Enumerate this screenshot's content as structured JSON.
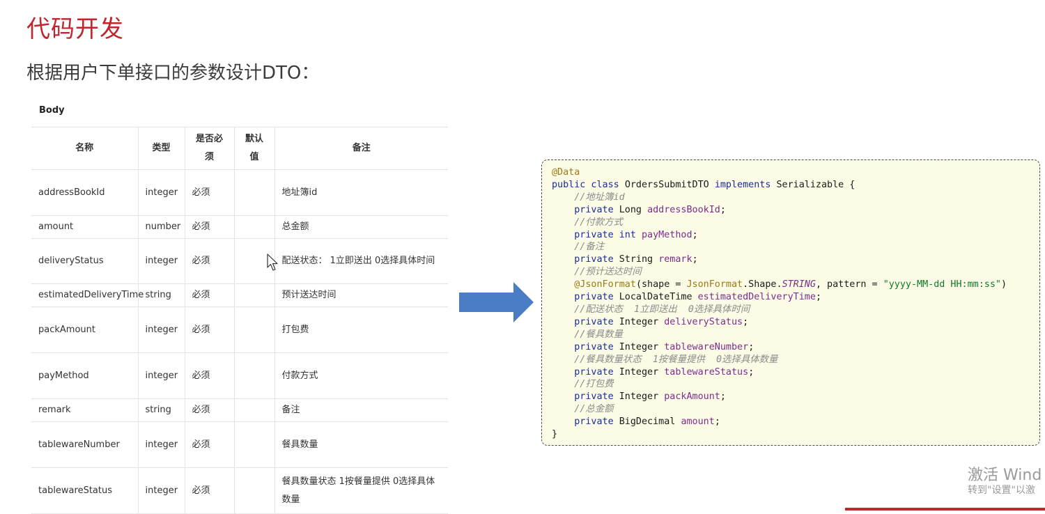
{
  "page": {
    "title": "代码开发",
    "subtitle": "根据用户下单接口的参数设计DTO："
  },
  "table": {
    "label": "Body",
    "headers": [
      "名称",
      "类型",
      "是否必须",
      "默认值",
      "备注"
    ],
    "rows": [
      {
        "name": "addressBookId",
        "type": "integer",
        "required": "必须",
        "default": "",
        "note": "地址簿id"
      },
      {
        "name": "amount",
        "type": "number",
        "required": "必须",
        "default": "",
        "note": "总金额"
      },
      {
        "name": "deliveryStatus",
        "type": "integer",
        "required": "必须",
        "default": "",
        "note": "配送状态： 1立即送出 0选择具体时间"
      },
      {
        "name": "estimatedDeliveryTime",
        "type": "string",
        "required": "必须",
        "default": "",
        "note": "预计送达时间"
      },
      {
        "name": "packAmount",
        "type": "integer",
        "required": "必须",
        "default": "",
        "note": "打包费"
      },
      {
        "name": "payMethod",
        "type": "integer",
        "required": "必须",
        "default": "",
        "note": "付款方式"
      },
      {
        "name": "remark",
        "type": "string",
        "required": "必须",
        "default": "",
        "note": "备注"
      },
      {
        "name": "tablewareNumber",
        "type": "integer",
        "required": "必须",
        "default": "",
        "note": "餐具数量"
      },
      {
        "name": "tablewareStatus",
        "type": "integer",
        "required": "必须",
        "default": "",
        "note": "餐具数量状态 1按餐量提供 0选择具体数量"
      }
    ]
  },
  "code": {
    "lines": [
      [
        {
          "t": "@Data",
          "c": "ann"
        }
      ],
      [
        {
          "t": "public class ",
          "c": "kw"
        },
        {
          "t": "OrdersSubmitDTO ",
          "c": ""
        },
        {
          "t": "implements ",
          "c": "kw"
        },
        {
          "t": "Serializable {",
          "c": ""
        }
      ],
      [
        {
          "t": "    //地址簿id",
          "c": "cmt"
        }
      ],
      [
        {
          "t": "    private ",
          "c": "kw"
        },
        {
          "t": "Long ",
          "c": ""
        },
        {
          "t": "addressBookId",
          "c": "fld"
        },
        {
          "t": ";",
          "c": ""
        }
      ],
      [
        {
          "t": "    //付款方式",
          "c": "cmt"
        }
      ],
      [
        {
          "t": "    private int ",
          "c": "kw"
        },
        {
          "t": "payMethod",
          "c": "fld"
        },
        {
          "t": ";",
          "c": ""
        }
      ],
      [
        {
          "t": "    //备注",
          "c": "cmt"
        }
      ],
      [
        {
          "t": "    private ",
          "c": "kw"
        },
        {
          "t": "String ",
          "c": ""
        },
        {
          "t": "remark",
          "c": "fld"
        },
        {
          "t": ";",
          "c": ""
        }
      ],
      [
        {
          "t": "    //预计送达时间",
          "c": "cmt"
        }
      ],
      [
        {
          "t": "    @JsonFormat",
          "c": "ann"
        },
        {
          "t": "(shape = ",
          "c": ""
        },
        {
          "t": "JsonFormat",
          "c": "ann"
        },
        {
          "t": ".Shape.",
          "c": ""
        },
        {
          "t": "STRING",
          "c": "cnst"
        },
        {
          "t": ", pattern = ",
          "c": ""
        },
        {
          "t": "\"yyyy-MM-dd HH:mm:ss\"",
          "c": "str"
        },
        {
          "t": ")",
          "c": ""
        }
      ],
      [
        {
          "t": "    private ",
          "c": "kw"
        },
        {
          "t": "LocalDateTime ",
          "c": ""
        },
        {
          "t": "estimatedDeliveryTime",
          "c": "fld"
        },
        {
          "t": ";",
          "c": ""
        }
      ],
      [
        {
          "t": "    //配送状态  1立即送出  0选择具体时间",
          "c": "cmt"
        }
      ],
      [
        {
          "t": "    private ",
          "c": "kw"
        },
        {
          "t": "Integer ",
          "c": ""
        },
        {
          "t": "deliveryStatus",
          "c": "fld"
        },
        {
          "t": ";",
          "c": ""
        }
      ],
      [
        {
          "t": "    //餐具数量",
          "c": "cmt"
        }
      ],
      [
        {
          "t": "    private ",
          "c": "kw"
        },
        {
          "t": "Integer ",
          "c": ""
        },
        {
          "t": "tablewareNumber",
          "c": "fld"
        },
        {
          "t": ";",
          "c": ""
        }
      ],
      [
        {
          "t": "    //餐具数量状态  1按餐量提供  0选择具体数量",
          "c": "cmt"
        }
      ],
      [
        {
          "t": "    private ",
          "c": "kw"
        },
        {
          "t": "Integer ",
          "c": ""
        },
        {
          "t": "tablewareStatus",
          "c": "fld"
        },
        {
          "t": ";",
          "c": ""
        }
      ],
      [
        {
          "t": "    //打包费",
          "c": "cmt"
        }
      ],
      [
        {
          "t": "    private ",
          "c": "kw"
        },
        {
          "t": "Integer ",
          "c": ""
        },
        {
          "t": "packAmount",
          "c": "fld"
        },
        {
          "t": ";",
          "c": ""
        }
      ],
      [
        {
          "t": "    //总金额",
          "c": "cmt"
        }
      ],
      [
        {
          "t": "    private ",
          "c": "kw"
        },
        {
          "t": "BigDecimal ",
          "c": ""
        },
        {
          "t": "amount",
          "c": "fld"
        },
        {
          "t": ";",
          "c": ""
        }
      ],
      [
        {
          "t": "}",
          "c": ""
        }
      ]
    ]
  },
  "watermark": {
    "line1": "激活 Wind",
    "line2": "转到\"设置\"以激"
  },
  "icons": {
    "arrow": "arrow-right-icon",
    "cursor": "mouse-cursor-icon"
  },
  "colors": {
    "title": "#c0262d",
    "arrow": "#4a7dc6",
    "code_bg": "#fbfbe6"
  }
}
